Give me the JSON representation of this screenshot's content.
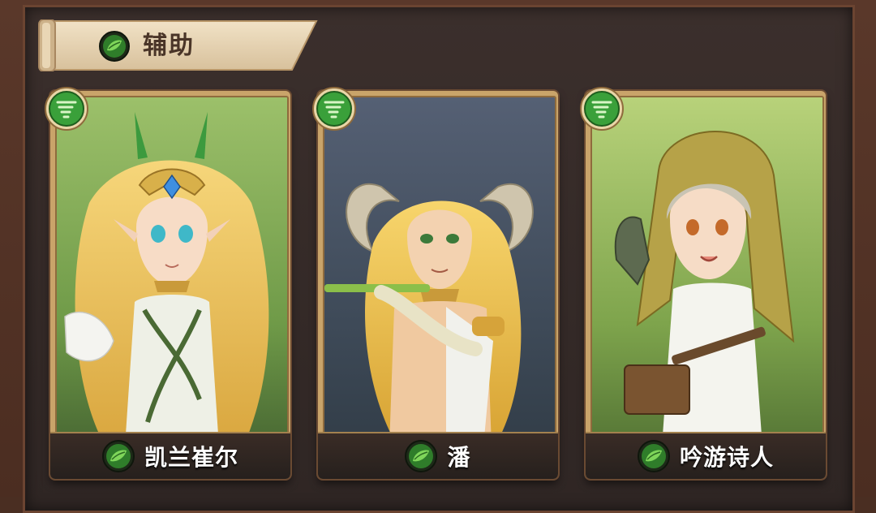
{
  "section": {
    "title": "辅助",
    "icon": "leaf-support-icon"
  },
  "theme": {
    "frame": "#4b2d21",
    "panel": "#2f2624",
    "banner": "#e7d3b4",
    "card_border": "#c9a46a",
    "badge_green": "#3aa03a"
  },
  "heroes": [
    {
      "name": "凯兰崔尔",
      "role_icon": "wind-swirl-icon",
      "name_icon": "leaf-support-icon",
      "art": "elf-priestess-portrait"
    },
    {
      "name": "潘",
      "role_icon": "wind-swirl-icon",
      "name_icon": "leaf-support-icon",
      "art": "satyr-flute-portrait"
    },
    {
      "name": "吟游诗人",
      "role_icon": "wind-swirl-icon",
      "name_icon": "leaf-support-icon",
      "art": "hooded-bard-portrait"
    }
  ]
}
